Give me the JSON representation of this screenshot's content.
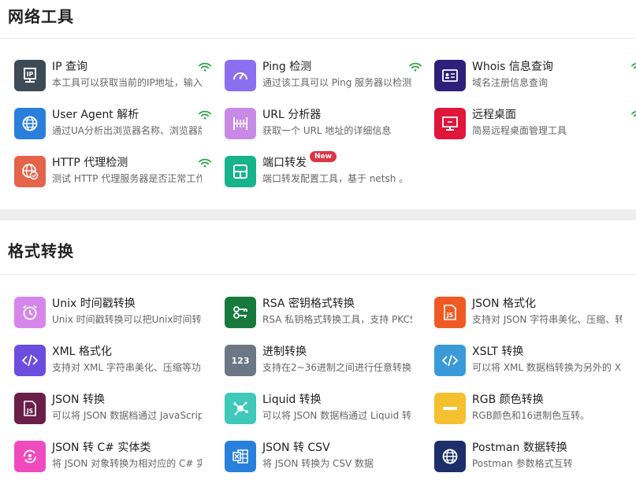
{
  "sections": [
    {
      "title": "网络工具",
      "tools": [
        {
          "name": "IP 查询",
          "desc": "本工具可以获取当前的IP地址，输入",
          "color": "#3d4b57",
          "icon": "ip-icon",
          "online": true
        },
        {
          "name": "Ping 检测",
          "desc": "通过该工具可以 Ping 服务器以检测",
          "color": "#8b6ff0",
          "icon": "gauge-icon",
          "online": true
        },
        {
          "name": "Whois 信息查询",
          "desc": "域名注册信息查询",
          "color": "#2e1f7a",
          "icon": "id-card-icon",
          "online": true
        },
        {
          "name": "User Agent 解析",
          "desc": "通过UA分析出浏览器名称、浏览器版",
          "color": "#2a7fdc",
          "icon": "globe-icon",
          "online": true
        },
        {
          "name": "URL 分析器",
          "desc": "获取一个 URL 地址的详细信息",
          "color": "#c98ae6",
          "icon": "ruler-icon",
          "online": false
        },
        {
          "name": "远程桌面",
          "desc": "简易远程桌面管理工具",
          "color": "#e0163a",
          "icon": "remote-desktop-icon",
          "online": true
        },
        {
          "name": "HTTP 代理检测",
          "desc": "测试 HTTP 代理服务器是否正常工作",
          "color": "#e3644a",
          "icon": "globe-check-icon",
          "online": true
        },
        {
          "name": "端口转发",
          "desc": "端口转发配置工具，基于 netsh 。",
          "color": "#16b38c",
          "icon": "layout-icon",
          "online": false,
          "badge": "New"
        }
      ]
    },
    {
      "title": "格式转换",
      "tools": [
        {
          "name": "Unix 时间戳转换",
          "desc": "Unix 时间戳转换可以把Unix时间转",
          "color": "#d686ea",
          "icon": "alarm-clock-icon"
        },
        {
          "name": "RSA 密钥格式转换",
          "desc": "RSA 私钥格式转换工具，支持 PKCS",
          "color": "#177a3c",
          "icon": "key-icon"
        },
        {
          "name": "JSON 格式化",
          "desc": "支持对 JSON 字符串美化、压缩、转",
          "color": "#ef5a24",
          "icon": "js-file-icon"
        },
        {
          "name": "XML 格式化",
          "desc": "支持对 XML 字符串美化、压缩等功",
          "color": "#6b4de0",
          "icon": "code-icon"
        },
        {
          "name": "进制转换",
          "desc": "支持在2~36进制之间进行任意转换,",
          "color": "#6b7785",
          "icon": "numbers-icon"
        },
        {
          "name": "XSLT 转换",
          "desc": "可以将 XML 数据档转换为另外的 X",
          "color": "#3a9ad9",
          "icon": "code-icon"
        },
        {
          "name": "JSON 转换",
          "desc": "可以将 JSON 数据档通过 JavaScrip",
          "color": "#6a1f48",
          "icon": "js-file-icon"
        },
        {
          "name": "Liquid 转换",
          "desc": "可以将 JSON 数据档通过 Liquid 转",
          "color": "#3ec9b8",
          "icon": "splash-icon"
        },
        {
          "name": "RGB 颜色转换",
          "desc": "RGB颜色和16进制色互转。",
          "color": "#f5c02d",
          "icon": "minus-bar-icon"
        },
        {
          "name": "JSON 转 C# 实体类",
          "desc": "将 JSON 对象转换为相对应的 C# 实",
          "color": "#f04bbe",
          "icon": "refresh-person-icon"
        },
        {
          "name": "JSON 转 CSV",
          "desc": "将 JSON 转换为 CSV 数据",
          "color": "#2a7fdc",
          "icon": "excel-icon"
        },
        {
          "name": "Postman 数据转换",
          "desc": "Postman 参数格式互转",
          "color": "#1c2f6b",
          "icon": "globe-icon"
        }
      ]
    }
  ]
}
